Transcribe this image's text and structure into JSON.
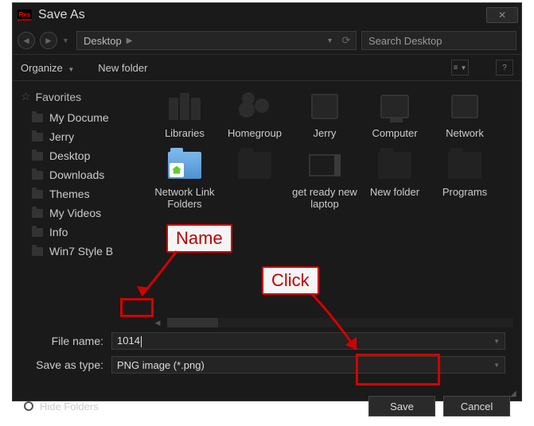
{
  "title": "Save As",
  "nav": {
    "breadcrumb_location": "Desktop",
    "search_placeholder": "Search Desktop"
  },
  "toolbar": {
    "organize": "Organize",
    "newfolder": "New folder"
  },
  "sidebar": {
    "header": "Favorites",
    "items": [
      {
        "label": "My Docume"
      },
      {
        "label": "Jerry"
      },
      {
        "label": "Desktop"
      },
      {
        "label": "Downloads"
      },
      {
        "label": "Themes"
      },
      {
        "label": "My Videos"
      },
      {
        "label": "Info"
      },
      {
        "label": "Win7 Style B"
      }
    ]
  },
  "files": [
    {
      "label": "Libraries",
      "icon": "libraries"
    },
    {
      "label": "Homegroup",
      "icon": "homegroup"
    },
    {
      "label": "Jerry",
      "icon": "user"
    },
    {
      "label": "Computer",
      "icon": "computer"
    },
    {
      "label": "Network",
      "icon": "network"
    },
    {
      "label": "Network Link Folders",
      "icon": "bluefolder"
    },
    {
      "label": "",
      "icon": "darkfolder"
    },
    {
      "label": "get ready new laptop",
      "icon": "laptop"
    },
    {
      "label": "New folder",
      "icon": "darkfolder"
    },
    {
      "label": "Programs",
      "icon": "darkfolder"
    }
  ],
  "fields": {
    "filename_label": "File name:",
    "filename_value": "1014",
    "savetype_label": "Save as type:",
    "savetype_value": "PNG image (*.png)"
  },
  "footer": {
    "hide": "Hide Folders",
    "save": "Save",
    "cancel": "Cancel"
  },
  "annotations": {
    "name_label": "Name",
    "click_label": "Click"
  }
}
